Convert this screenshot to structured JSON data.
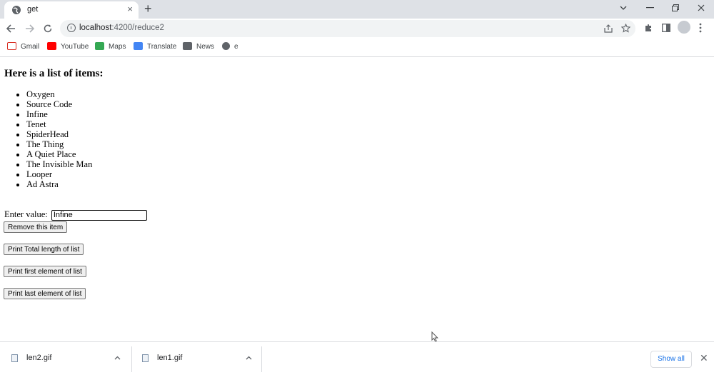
{
  "browser": {
    "tab_title": "get",
    "url_host": "localhost",
    "url_path": ":4200/reduce2",
    "new_tab_symbol": "+",
    "tab_close_symbol": "×",
    "bookmarks": [
      {
        "label": "Gmail",
        "icon": "gmail-icon",
        "color": "#d93025"
      },
      {
        "label": "YouTube",
        "icon": "youtube-icon",
        "color": "#ff0000"
      },
      {
        "label": "Maps",
        "icon": "maps-icon",
        "color": "#34a853"
      },
      {
        "label": "Translate",
        "icon": "translate-icon",
        "color": "#4285f4"
      },
      {
        "label": "News",
        "icon": "news-icon",
        "color": "#5f6368"
      },
      {
        "label": "e",
        "icon": "globe-icon",
        "color": "#5f6368"
      }
    ]
  },
  "page": {
    "heading": "Here is a list of items:",
    "items": [
      "Oxygen",
      "Source Code",
      "Infine",
      "Tenet",
      "SpiderHead",
      "The Thing",
      "A Quiet Place",
      "The Invisible Man",
      "Looper",
      "Ad Astra"
    ],
    "enter_label": "Enter value:",
    "enter_value": "Infine",
    "remove_button": "Remove this item",
    "total_button": "Print Total length of list",
    "first_button": "Print first element of list",
    "last_button": "Print last element of list"
  },
  "downloads": {
    "files": [
      "len2.gif",
      "len1.gif"
    ],
    "show_all": "Show all",
    "close_symbol": "✕"
  }
}
